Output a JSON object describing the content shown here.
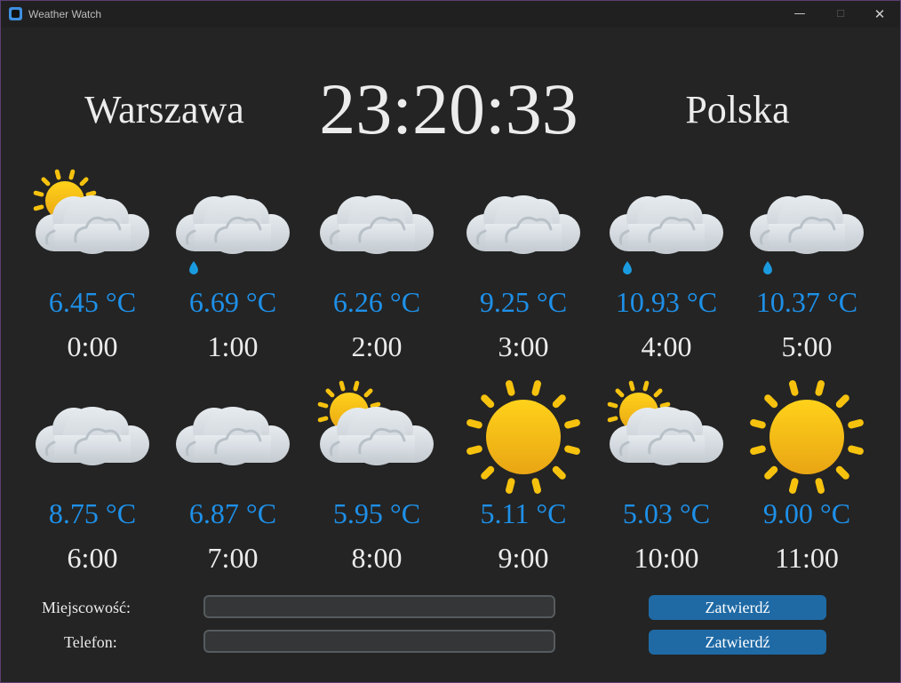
{
  "window": {
    "title": "Weather Watch",
    "minimize_glyph": "—",
    "maximize_glyph": "☐",
    "close_glyph": "✕"
  },
  "header": {
    "city": "Warszawa",
    "time": "23:20:33",
    "country": "Polska"
  },
  "forecast": [
    {
      "temp": "6.45 °C",
      "hour": "0:00",
      "icon": "partly-cloudy-icon"
    },
    {
      "temp": "6.69 °C",
      "hour": "1:00",
      "icon": "light-rain-icon"
    },
    {
      "temp": "6.26 °C",
      "hour": "2:00",
      "icon": "cloud-icon"
    },
    {
      "temp": "9.25 °C",
      "hour": "3:00",
      "icon": "cloud-icon"
    },
    {
      "temp": "10.93 °C",
      "hour": "4:00",
      "icon": "light-rain-icon"
    },
    {
      "temp": "10.37 °C",
      "hour": "5:00",
      "icon": "light-rain-icon"
    },
    {
      "temp": "8.75 °C",
      "hour": "6:00",
      "icon": "cloud-icon"
    },
    {
      "temp": "6.87 °C",
      "hour": "7:00",
      "icon": "cloud-icon"
    },
    {
      "temp": "5.95 °C",
      "hour": "8:00",
      "icon": "partly-cloudy-icon"
    },
    {
      "temp": "5.11 °C",
      "hour": "9:00",
      "icon": "sun-icon"
    },
    {
      "temp": "5.03 °C",
      "hour": "10:00",
      "icon": "partly-cloudy-icon"
    },
    {
      "temp": "9.00 °C",
      "hour": "11:00",
      "icon": "sun-icon"
    }
  ],
  "form": {
    "city_label": "Miejscowość:",
    "city_value": "",
    "phone_label": "Telefon:",
    "phone_value": "",
    "submit_label": "Zatwierdź"
  },
  "colors": {
    "background": "#242424",
    "temperature": "#1e90e8",
    "button": "#1f6aa5",
    "sun": "#f6c20e",
    "cloud": "#d3d9de",
    "rain": "#1a9be0"
  }
}
